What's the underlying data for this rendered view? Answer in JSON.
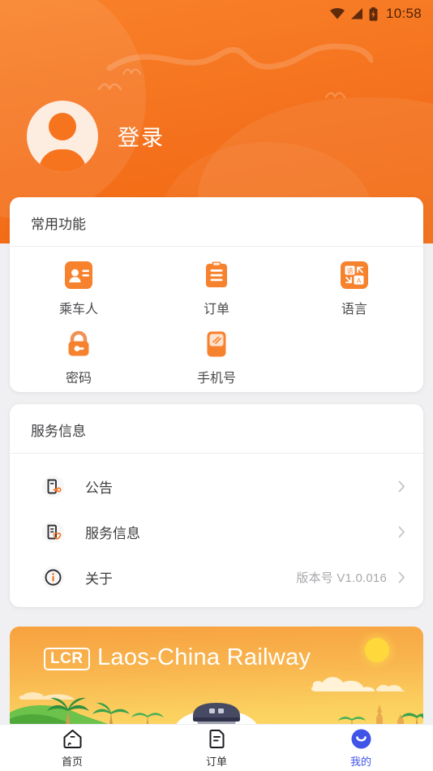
{
  "status_bar": {
    "time": "10:58",
    "icons": [
      "wifi-icon",
      "cellular-signal-icon",
      "battery-charging-icon"
    ]
  },
  "header": {
    "login_label": "登录",
    "avatar_icon": "default-user-avatar",
    "background_color": "#f4701c"
  },
  "common_functions": {
    "title": "常用功能",
    "items": [
      {
        "label": "乘车人",
        "icon": "passenger-icon"
      },
      {
        "label": "订单",
        "icon": "order-clipboard-icon"
      },
      {
        "label": "语言",
        "icon": "language-translate-icon"
      },
      {
        "label": "密码",
        "icon": "password-lock-icon"
      },
      {
        "label": "手机号",
        "icon": "phone-number-icon"
      }
    ]
  },
  "service_info": {
    "title": "服务信息",
    "rows": [
      {
        "label": "公告",
        "icon": "announcement-icon",
        "value": ""
      },
      {
        "label": "服务信息",
        "icon": "service-info-icon",
        "value": ""
      },
      {
        "label": "关于",
        "icon": "about-info-icon",
        "value": "版本号 V1.0.016"
      }
    ]
  },
  "banner": {
    "logo_line1": "LCR",
    "title": "Laos-China Railway"
  },
  "tabbar": {
    "tabs": [
      {
        "label": "首页",
        "icon": "home-icon",
        "active": false
      },
      {
        "label": "订单",
        "icon": "order-icon",
        "active": false
      },
      {
        "label": "我的",
        "icon": "profile-icon",
        "active": true
      }
    ],
    "active_color": "#4054e8"
  }
}
